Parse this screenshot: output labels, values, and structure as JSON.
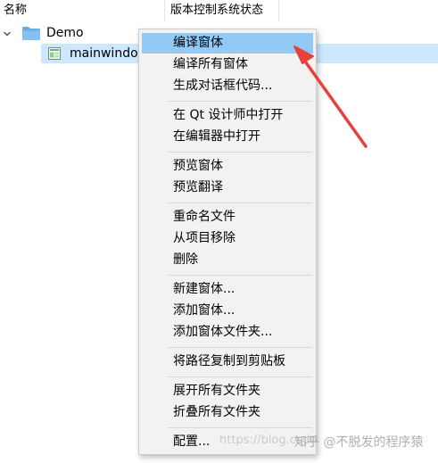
{
  "header": {
    "col_name": "名称",
    "col_vcs": "版本控制系统状态"
  },
  "tree": {
    "project": {
      "label": "Demo",
      "icon": "folder-icon",
      "expanded": true
    },
    "file": {
      "label": "mainwindo",
      "icon": "ui-form-file-icon",
      "selected": true
    }
  },
  "context_menu": {
    "items": [
      {
        "label": "编译窗体",
        "active": true
      },
      {
        "label": "编译所有窗体"
      },
      {
        "label": "生成对话框代码..."
      },
      {
        "label": "在 Qt 设计师中打开"
      },
      {
        "label": "在编辑器中打开"
      },
      {
        "label": "预览窗体"
      },
      {
        "label": "预览翻译"
      },
      {
        "label": "重命名文件"
      },
      {
        "label": "从项目移除"
      },
      {
        "label": "删除"
      },
      {
        "label": "新建窗体..."
      },
      {
        "label": "添加窗体..."
      },
      {
        "label": "添加窗体文件夹..."
      },
      {
        "label": "将路径复制到剪贴板"
      },
      {
        "label": "展开所有文件夹"
      },
      {
        "label": "折叠所有文件夹"
      },
      {
        "label": "配置..."
      }
    ]
  },
  "watermarks": {
    "url": "https://blog.csdn",
    "zhihu": "知乎 @不脱发的程序猿"
  },
  "colors": {
    "selection": "#cce8ff",
    "menu_highlight": "#91c9f7",
    "menu_background": "#f2f2f2",
    "arrow": "#e8413c",
    "folder": "#6aaee8"
  }
}
